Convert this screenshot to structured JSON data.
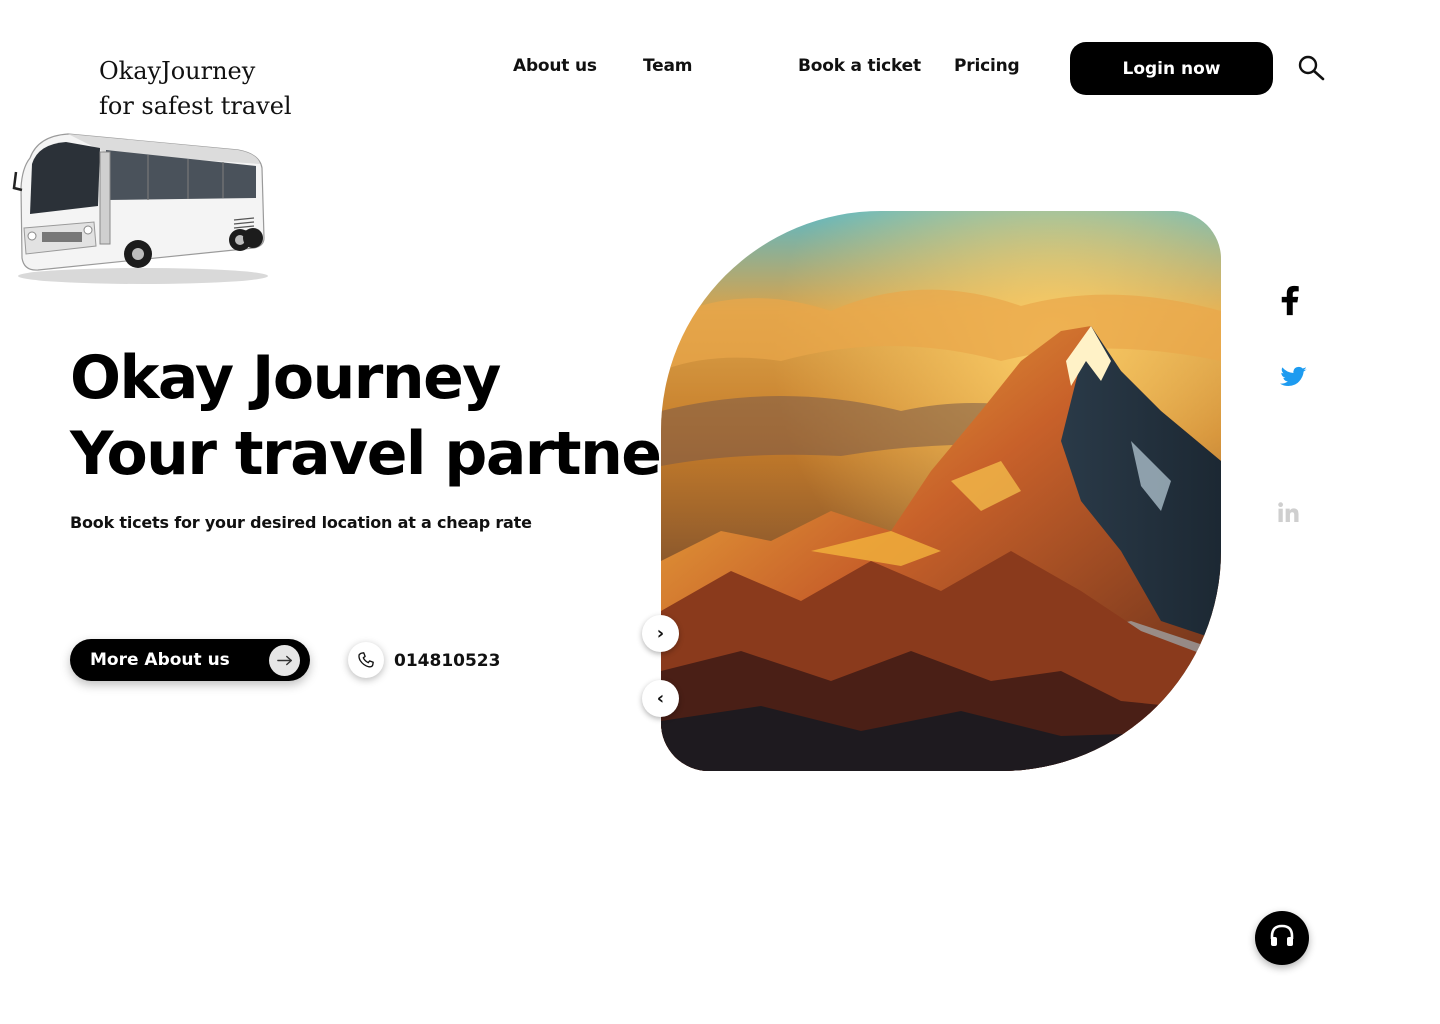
{
  "brand": {
    "line1": "OkayJourney",
    "line2": "for safest travel"
  },
  "nav": {
    "about": "About us",
    "team": "Team",
    "book": "Book a ticket",
    "pricing": "Pricing",
    "login": "Login now"
  },
  "hero": {
    "title_line1": "Okay Journey",
    "title_line2": "Your travel partner",
    "subtitle": "Book ticets for your desired location at a cheap rate",
    "cta_label": "More About us",
    "phone": "014810523"
  },
  "carousel": {
    "next": "›",
    "prev": "‹"
  },
  "icons": {
    "bus": "bus-image",
    "search": "search-icon",
    "arrow": "arrow-right-icon",
    "phone": "phone-icon",
    "facebook": "facebook-icon",
    "twitter": "twitter-icon",
    "linkedin": "linkedin-icon",
    "support": "headphones-icon"
  },
  "colors": {
    "primary": "#000000",
    "twitter": "#1d9bf0",
    "linkedin": "#cfcfcf",
    "background": "#ffffff"
  }
}
